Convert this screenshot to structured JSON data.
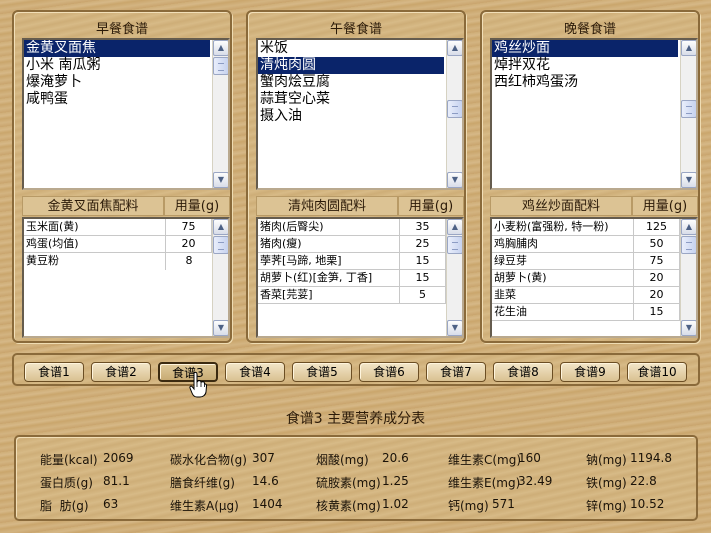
{
  "panels": [
    {
      "title": "早餐食谱",
      "dishes": [
        "金黄叉面焦",
        "小米 南瓜粥",
        "爆淹萝卜",
        "咸鸭蛋"
      ],
      "selected_index": 0,
      "ing_header": "金黄叉面焦配料",
      "amount_header": "用量(g)",
      "ingredients": [
        {
          "name": "玉米面(黄)",
          "amount": "75"
        },
        {
          "name": "鸡蛋(均值)",
          "amount": "20"
        },
        {
          "name": "黄豆粉",
          "amount": "8"
        }
      ]
    },
    {
      "title": "午餐食谱",
      "dishes": [
        "米饭",
        "清炖肉圆",
        "蟹肉烩豆腐",
        "蒜茸空心菜",
        "摄入油"
      ],
      "selected_index": 1,
      "ing_header": "清炖肉圆配料",
      "amount_header": "用量(g)",
      "ingredients": [
        {
          "name": "猪肉(后臀尖)",
          "amount": "35"
        },
        {
          "name": "猪肉(瘦)",
          "amount": "25"
        },
        {
          "name": "荸荠[马蹄, 地栗]",
          "amount": "15"
        },
        {
          "name": "胡萝卜(红)[金笋, 丁香]",
          "amount": "15"
        },
        {
          "name": "香菜[芫荽]",
          "amount": "5"
        }
      ]
    },
    {
      "title": "晚餐食谱",
      "dishes": [
        "鸡丝炒面",
        "焯拌双花",
        "西红柿鸡蛋汤"
      ],
      "selected_index": 0,
      "ing_header": "鸡丝炒面配料",
      "amount_header": "用量(g)",
      "ingredients": [
        {
          "name": "小麦粉(富强粉, 特一粉)",
          "amount": "125"
        },
        {
          "name": "鸡胸脯肉",
          "amount": "50"
        },
        {
          "name": "绿豆芽",
          "amount": "75"
        },
        {
          "name": "胡萝卜(黄)",
          "amount": "20"
        },
        {
          "name": "韭菜",
          "amount": "20"
        },
        {
          "name": "花生油",
          "amount": "15"
        }
      ]
    }
  ],
  "recipe_buttons": [
    "食谱1",
    "食谱2",
    "食谱3",
    "食谱4",
    "食谱5",
    "食谱6",
    "食谱7",
    "食谱8",
    "食谱9",
    "食谱10"
  ],
  "active_button_index": 2,
  "nutrition": {
    "title": "食谱3 主要营养成分表",
    "rows": [
      [
        {
          "label": "能量(kcal)",
          "value": "2069"
        },
        {
          "label": "碳水化合物(g)",
          "value": "307"
        },
        {
          "label": "烟酸(mg)",
          "value": "20.6"
        },
        {
          "label": "维生素C(mg)",
          "value": "160"
        },
        {
          "label": "钠(mg)",
          "value": "1194.8"
        }
      ],
      [
        {
          "label": "蛋白质(g)",
          "value": "81.1"
        },
        {
          "label": "膳食纤维(g)",
          "value": "14.6"
        },
        {
          "label": "硫胺素(mg)",
          "value": "1.25"
        },
        {
          "label": "维生素E(mg)",
          "value": "32.49"
        },
        {
          "label": "铁(mg)",
          "value": "22.8"
        }
      ],
      [
        {
          "label": "脂  肪(g)",
          "value": "63"
        },
        {
          "label": "维生素A(μg)",
          "value": "1404"
        },
        {
          "label": "核黄素(mg)",
          "value": "1.02"
        },
        {
          "label": "钙(mg)",
          "value": "571"
        },
        {
          "label": "锌(mg)",
          "value": "10.52"
        }
      ]
    ]
  }
}
